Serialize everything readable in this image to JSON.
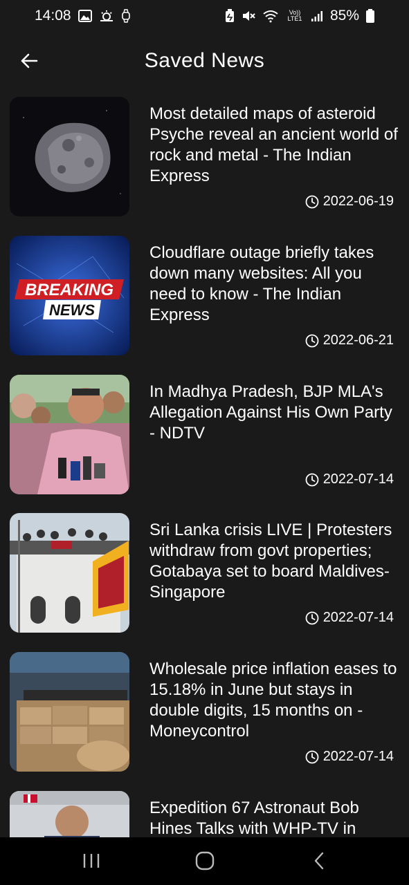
{
  "status_bar": {
    "time": "14:08",
    "battery": "85%",
    "left_icons": [
      "gallery-icon",
      "weather-icon",
      "watch-icon"
    ],
    "right_icons": [
      "battery-saver-icon",
      "mute-icon",
      "wifi-icon",
      "volte-icon",
      "signal-icon",
      "battery-icon"
    ],
    "volte_label": "Vo)) LTE1"
  },
  "header": {
    "title": "Saved News",
    "back_icon": "arrow-left-icon"
  },
  "news": [
    {
      "title": "Most detailed maps of asteroid Psyche reveal an ancient world of rock and metal - The Indian Express",
      "date": "2022-06-19",
      "thumb": "asteroid"
    },
    {
      "title": "Cloudflare outage briefly takes down many websites: All you need to know - The Indian Express",
      "date": "2022-06-21",
      "thumb": "breaking-news",
      "thumb_text_1": "BREAKING",
      "thumb_text_2": "NEWS"
    },
    {
      "title": "In Madhya Pradesh, BJP MLA's Allegation Against His Own Party - NDTV",
      "date": "2022-07-14",
      "thumb": "politician-crowd"
    },
    {
      "title": "Sri Lanka crisis LIVE | Protesters withdraw from govt properties; Gotabaya set to board Maldives-Singapore",
      "date": "2022-07-14",
      "thumb": "protest-building"
    },
    {
      "title": "Wholesale price inflation eases to 15.18% in June but stays in double digits, 15 months on - Moneycontrol",
      "date": "2022-07-14",
      "thumb": "sacks-market"
    },
    {
      "title": "Expedition 67 Astronaut Bob Hines Talks with WHP-TV in",
      "date": "",
      "thumb": "astronaut"
    }
  ],
  "nav": {
    "recents_icon": "recents-icon",
    "home_icon": "home-icon",
    "back_icon": "back-chevron-icon"
  }
}
